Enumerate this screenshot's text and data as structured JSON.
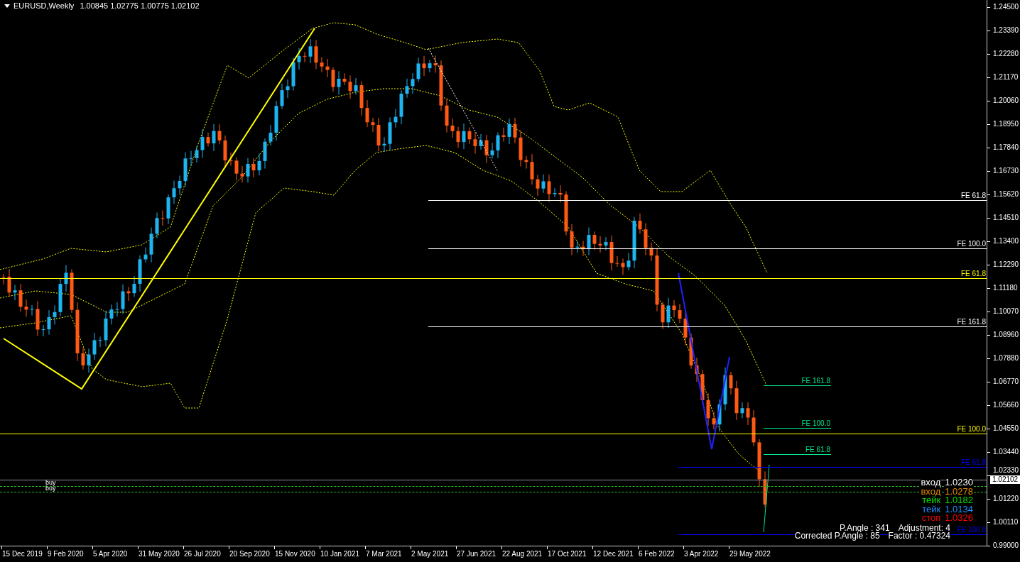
{
  "chart": {
    "symbol": "EURUSD,Weekly",
    "ohlc": "1.00845 1.02775 1.00775 1.02102"
  },
  "price_axis": [
    "1.24500",
    "1.23390",
    "1.22280",
    "1.21170",
    "1.20060",
    "1.18950",
    "1.17840",
    "1.16730",
    "1.15620",
    "1.14510",
    "1.13400",
    "1.12290",
    "1.11180",
    "1.10070",
    "1.08960",
    "1.07880",
    "1.06770",
    "1.05660",
    "1.04550",
    "1.03440",
    "1.02330",
    "1.01220",
    "1.00110",
    "0.99000"
  ],
  "current_price": "1.02102",
  "time_axis": [
    "15 Dec 2019",
    "9 Feb 2020",
    "5 Apr 2020",
    "31 May 2020",
    "26 Jul 2020",
    "20 Sep 2020",
    "15 Nov 2020",
    "10 Jan 2021",
    "7 Mar 2021",
    "2 May 2021",
    "27 Jun 2021",
    "22 Aug 2021",
    "17 Oct 2021",
    "12 Dec 2021",
    "6 Feb 2022",
    "3 Apr 2022",
    "29 May 2022"
  ],
  "levels": [
    {
      "label": "FE 61.8",
      "color": "#ffffff"
    },
    {
      "label": "FE 100.0",
      "color": "#ffffff"
    },
    {
      "label": "FE 61.8",
      "color": "#ffff00"
    },
    {
      "label": "FE 161.8",
      "color": "#ffffff"
    },
    {
      "label": "FE 161.8",
      "color": "#00e68a"
    },
    {
      "label": "FE 100.0",
      "color": "#00e68a"
    },
    {
      "label": "FE 100.0",
      "color": "#ffff00"
    },
    {
      "label": "FE 61.8",
      "color": "#00e68a"
    },
    {
      "label": "FE 61.8",
      "color": "#0000ff"
    },
    {
      "label": "FE 100.0",
      "color": "#0000ff"
    }
  ],
  "orders": [
    {
      "label": "buy"
    },
    {
      "label": "buy"
    }
  ],
  "trade_info": [
    {
      "label": "вход",
      "value": "1.0230",
      "color": "#ffffff"
    },
    {
      "label": "вход",
      "value": "1.0278",
      "color": "#e08c00"
    },
    {
      "label": "тейк",
      "value": "1.0182",
      "color": "#00e000"
    },
    {
      "label": "тейк",
      "value": "1.0134",
      "color": "#1e90ff"
    },
    {
      "label": "стоп",
      "value": "1.0326",
      "color": "#ff0000"
    }
  ],
  "angle_info": [
    {
      "items": [
        "P.Angle : 341",
        "Adjustment: 4"
      ]
    },
    {
      "items": [
        "Corrected P.Angle : 85",
        "Factor : 0.47324"
      ]
    }
  ]
}
